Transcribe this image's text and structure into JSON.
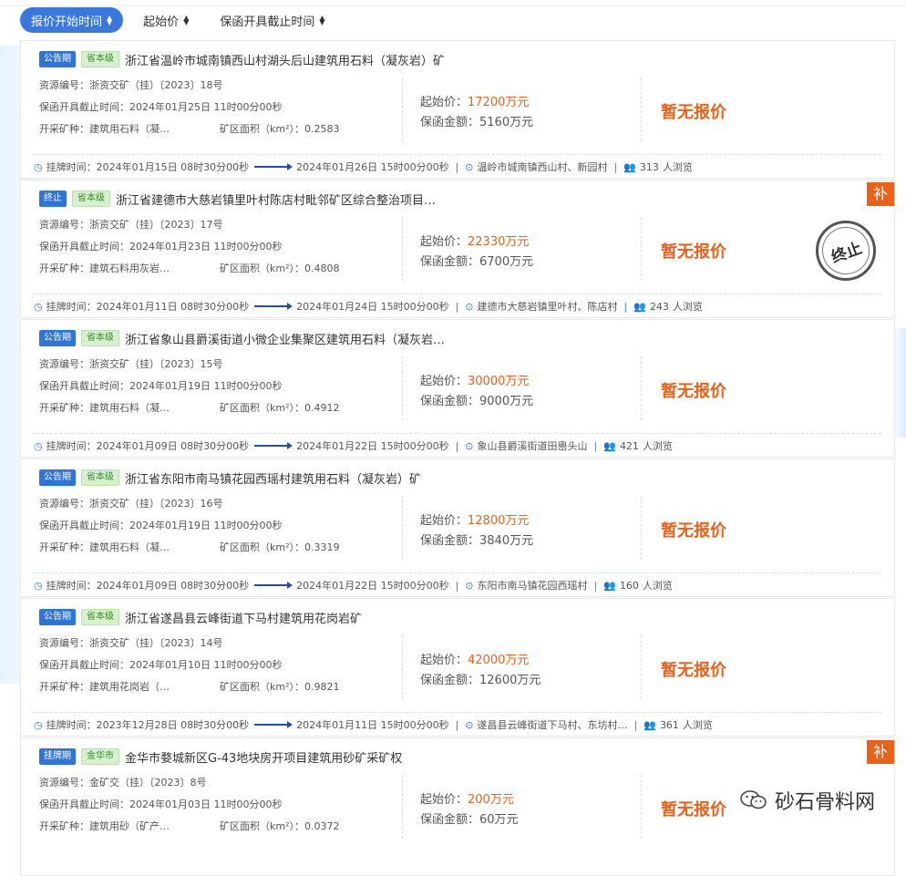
{
  "sort": {
    "items": [
      {
        "label": "报价开始时间",
        "active": true
      },
      {
        "label": "起始价",
        "active": false
      },
      {
        "label": "保函开具截止时间",
        "active": false
      }
    ]
  },
  "labels": {
    "resource": "资源编号：",
    "deadline": "保函开具截止时间：",
    "mineral": "开采矿种：",
    "area": "矿区面积（km²）：",
    "start_price": "起始价：",
    "deposit": "保函金额：",
    "listing": "挂牌时间：",
    "views_suffix": "人浏览"
  },
  "cards": [
    {
      "status": "公告期",
      "level": "省本级",
      "title": "浙江省温岭市城南镇西山村湖头后山建筑用石料（凝灰岩）矿",
      "resource": "浙资交矿（挂）〔2023〕18号",
      "deadline": "2024年01月25日 11时00分00秒",
      "mineral": "建筑用石料（凝…",
      "area": "0.2583",
      "start_price": "17200万元",
      "deposit": "5160万元",
      "quote": "暂无报价",
      "listing_start": "2024年01月15日 08时30分00秒",
      "listing_end": "2024年01月26日 15时00分00秒",
      "location": "温岭市城南镇西山村、新园村",
      "views": "313",
      "bu": "",
      "stamp": ""
    },
    {
      "status": "终止",
      "level": "省本级",
      "title": "浙江省建德市大慈岩镇里叶村陈店村毗邻矿区综合整治项目…",
      "resource": "浙资交矿（挂）〔2023〕17号",
      "deadline": "2024年01月23日 11时00分00秒",
      "mineral": "建筑石料用灰岩…",
      "area": "0.4808",
      "start_price": "22330万元",
      "deposit": "6700万元",
      "quote": "暂无报价",
      "listing_start": "2024年01月11日 08时30分00秒",
      "listing_end": "2024年01月24日 15时00分00秒",
      "location": "建德市大慈岩镇里叶村、陈店村",
      "views": "243",
      "bu": "补",
      "stamp": "终止"
    },
    {
      "status": "公告期",
      "level": "省本级",
      "title": "浙江省象山县爵溪街道小微企业集聚区建筑用石料（凝灰岩…",
      "resource": "浙资交矿（挂）〔2023〕15号",
      "deadline": "2024年01月19日 11时00分00秒",
      "mineral": "建筑用石料（凝…",
      "area": "0.4912",
      "start_price": "30000万元",
      "deposit": "9000万元",
      "quote": "暂无报价",
      "listing_start": "2024年01月09日 08时30分00秒",
      "listing_end": "2024年01月22日 15时00分00秒",
      "location": "象山县爵溪街道田嶴头山",
      "views": "421",
      "bu": "",
      "stamp": ""
    },
    {
      "status": "公告期",
      "level": "省本级",
      "title": "浙江省东阳市南马镇花园西瑶村建筑用石料（凝灰岩）矿",
      "resource": "浙资交矿（挂）〔2023〕16号",
      "deadline": "2024年01月19日 11时00分00秒",
      "mineral": "建筑用石料（凝…",
      "area": "0.3319",
      "start_price": "12800万元",
      "deposit": "3840万元",
      "quote": "暂无报价",
      "listing_start": "2024年01月09日 08时30分00秒",
      "listing_end": "2024年01月22日 15时00分00秒",
      "location": "东阳市南马镇花园西瑶村",
      "views": "160",
      "bu": "",
      "stamp": ""
    },
    {
      "status": "公告期",
      "level": "省本级",
      "title": "浙江省遂昌县云峰街道下马村建筑用花岗岩矿",
      "resource": "浙资交矿（挂）〔2023〕14号",
      "deadline": "2024年01月10日 11时00分00秒",
      "mineral": "建筑用花岗岩（…",
      "area": "0.9821",
      "start_price": "42000万元",
      "deposit": "12600万元",
      "quote": "暂无报价",
      "listing_start": "2023年12月28日 08时30分00秒",
      "listing_end": "2024年01月11日 15时00分00秒",
      "location": "遂昌县云峰街道下马村、东坊村…",
      "views": "361",
      "bu": "",
      "stamp": ""
    },
    {
      "status": "挂牌期",
      "level": "金华市",
      "title": "金华市婺城新区G-43地块房开项目建筑用砂矿采矿权",
      "resource": "金矿交（挂）〔2023〕8号",
      "deadline": "2024年01月03日 11时00分00秒",
      "mineral": "建筑用砂（矿产…",
      "area": "0.0372",
      "start_price": "200万元",
      "deposit": "60万元",
      "quote": "暂无报价",
      "listing_start": "",
      "listing_end": "",
      "location": "",
      "views": "",
      "bu": "补",
      "stamp": ""
    }
  ],
  "watermark": "砂石骨料网",
  "icons": {
    "clock": "clock-icon",
    "location": "location-pin-icon",
    "users": "users-icon",
    "sort": "sort-caret-icon",
    "wechat": "wechat-icon"
  },
  "colors": {
    "primary": "#3a78e0",
    "price": "#e8621a",
    "level_bg": "#d7f0cf",
    "level_fg": "#3a8a29"
  }
}
